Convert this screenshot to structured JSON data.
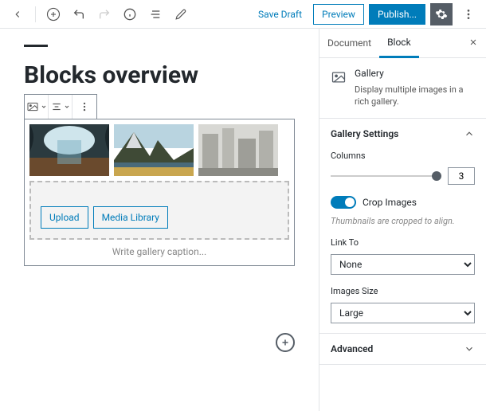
{
  "topbar": {
    "save_draft": "Save Draft",
    "preview": "Preview",
    "publish": "Publish..."
  },
  "editor": {
    "title": "Blocks overview",
    "dropzone": {
      "upload": "Upload",
      "media_library": "Media Library"
    },
    "caption_placeholder": "Write gallery caption..."
  },
  "sidebar": {
    "tabs": {
      "document": "Document",
      "block": "Block"
    },
    "block_info": {
      "name": "Gallery",
      "desc": "Display multiple images in a rich gallery."
    },
    "gallery_settings": {
      "heading": "Gallery Settings",
      "columns_label": "Columns",
      "columns_value": "3",
      "crop_label": "Crop Images",
      "crop_hint": "Thumbnails are cropped to align.",
      "link_to_label": "Link To",
      "link_to_value": "None",
      "image_size_label": "Images Size",
      "image_size_value": "Large"
    },
    "advanced": {
      "heading": "Advanced"
    }
  }
}
